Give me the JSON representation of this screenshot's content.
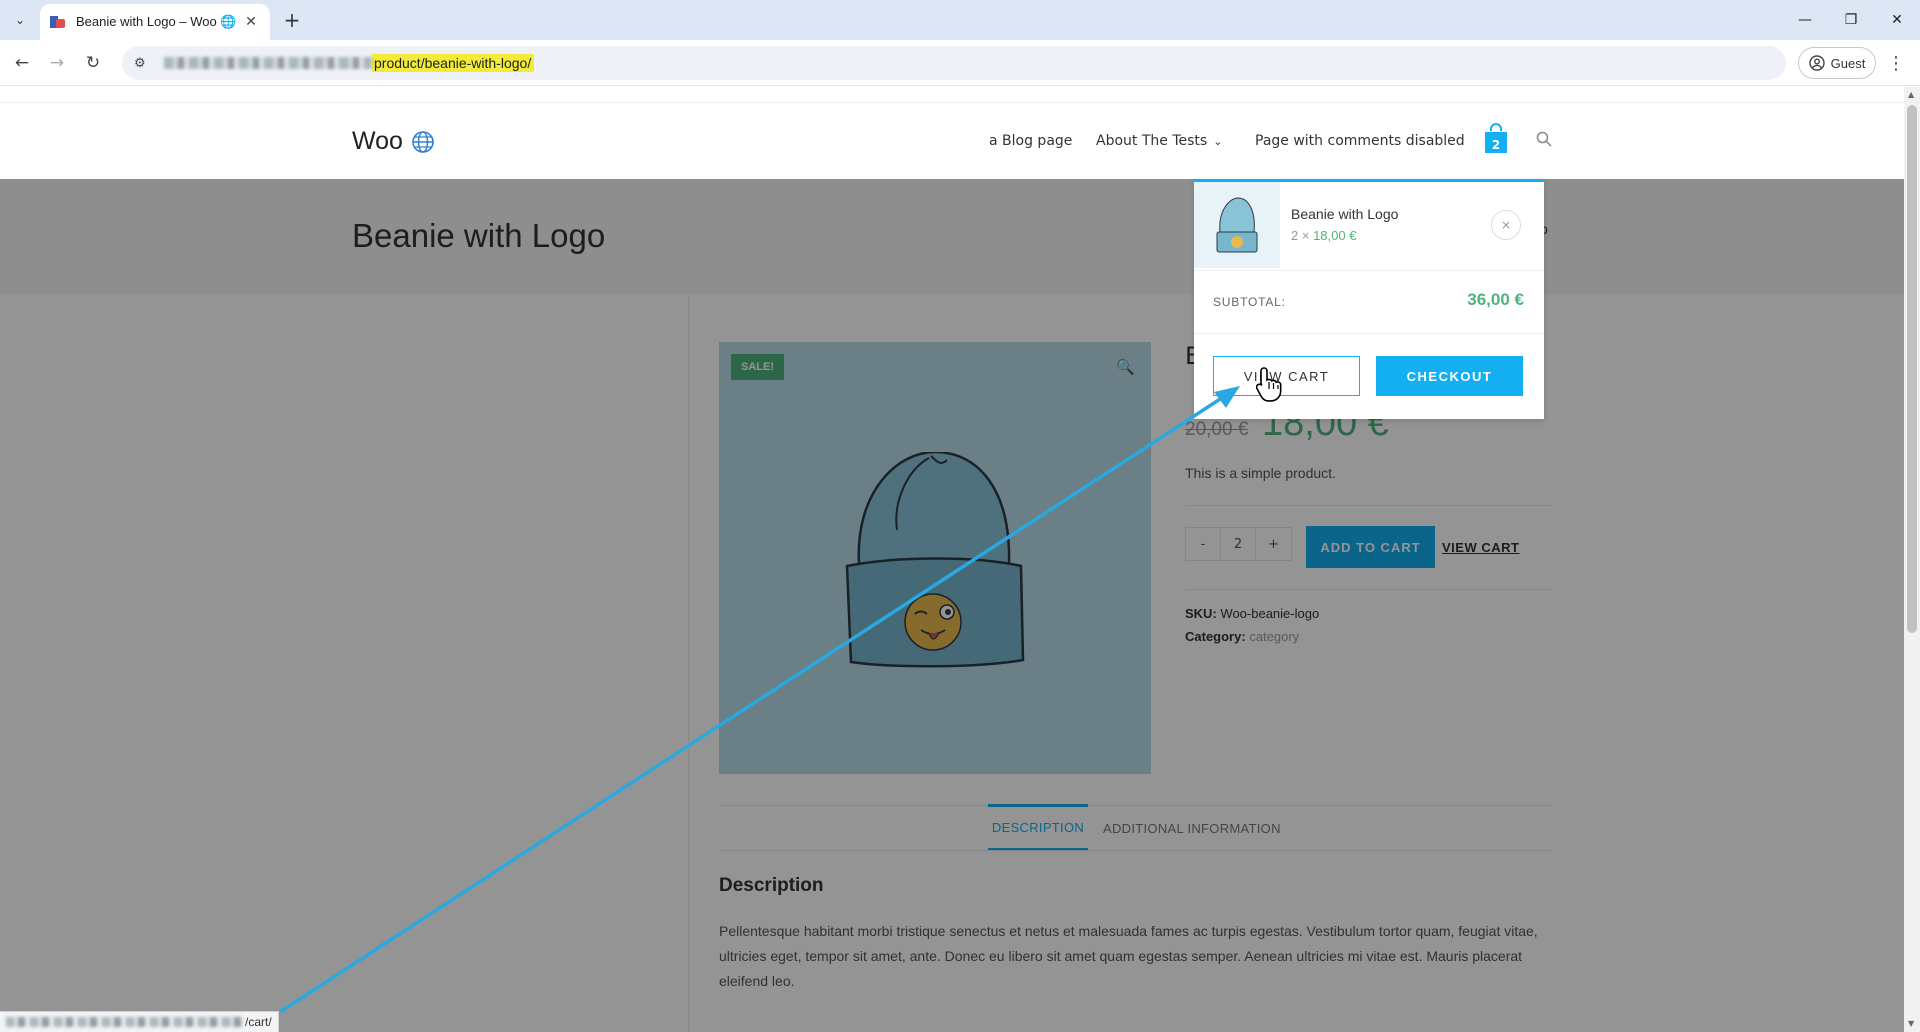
{
  "browser": {
    "tab_title": "Beanie with Logo – Woo 🌐",
    "url_visible": "product/beanie-with-logo/",
    "profile_label": "Guest",
    "status_url": "/cart/"
  },
  "header": {
    "logo_text": "Woo",
    "nav": [
      "a Blog page",
      "About The Tests",
      "Page with comments disabled"
    ],
    "cart_count": "2"
  },
  "page": {
    "title": "Beanie with Logo",
    "breadcrumb_tail": "o"
  },
  "product": {
    "sale_badge": "SALE!",
    "name_partial": "B",
    "price_old": "20,00 €",
    "price_new": "18,00 €",
    "short_description": "This is a simple product.",
    "qty_minus": "-",
    "qty_value": "2",
    "qty_plus": "+",
    "add_to_cart": "ADD TO CART",
    "view_cart": "VIEW CART",
    "sku_label": "SKU:",
    "sku_value": "Woo-beanie-logo",
    "category_label": "Category:",
    "category_value": "category"
  },
  "tabs": {
    "description": "DESCRIPTION",
    "additional": "ADDITIONAL INFORMATION"
  },
  "description": {
    "heading": "Description",
    "body": "Pellentesque habitant morbi tristique senectus et netus et malesuada fames ac turpis egestas. Vestibulum tortor quam, feugiat vitae, ultricies eget, tempor sit amet, ante. Donec eu libero sit amet quam egestas semper. Aenean ultricies mi vitae est. Mauris placerat eleifend leo."
  },
  "minicart": {
    "item_name": "Beanie with Logo",
    "item_qty": "2 ×",
    "item_price": "18,00 €",
    "remove_symbol": "×",
    "subtotal_label": "SUBTOTAL:",
    "subtotal_value": "36,00 €",
    "view_cart": "VIEW CART",
    "checkout": "CHECKOUT"
  },
  "colors": {
    "accent": "#13aff0",
    "price_green": "#4db47c",
    "image_bg": "#b8dbe9"
  }
}
